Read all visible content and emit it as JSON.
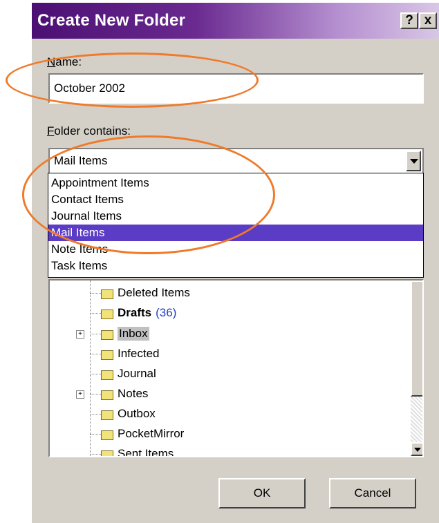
{
  "dialog": {
    "title": "Create New Folder",
    "help_glyph": "?",
    "close_glyph": "x"
  },
  "name_field": {
    "label_accel": "N",
    "label_rest": "ame:",
    "value": "October 2002"
  },
  "folder_contains": {
    "label_accel": "F",
    "label_rest": "older contains:",
    "selected": "Mail Items",
    "options": [
      "Appointment Items",
      "Contact Items",
      "Journal Items",
      "Mail Items",
      "Note Items",
      "Task Items"
    ]
  },
  "tree": {
    "items": [
      {
        "name": "Deleted Items",
        "icon": "deleted-items-folder-icon"
      },
      {
        "name": "Drafts",
        "count": "(36)",
        "icon": "drafts-folder-icon"
      },
      {
        "name": "Inbox",
        "icon": "inbox-folder-icon"
      },
      {
        "name": "Infected",
        "icon": "folder-icon"
      },
      {
        "name": "Journal",
        "icon": "journal-folder-icon"
      },
      {
        "name": "Notes",
        "icon": "notes-folder-icon"
      },
      {
        "name": "Outbox",
        "icon": "outbox-folder-icon"
      },
      {
        "name": "PocketMirror",
        "icon": "folder-icon"
      },
      {
        "name": "Sent Items",
        "icon": "sent-items-folder-icon"
      }
    ]
  },
  "buttons": {
    "ok": "OK",
    "cancel": "Cancel"
  },
  "colors": {
    "title_gradient_start": "#4b0f74",
    "selection": "#5b3cc4",
    "annotation": "#f07a2a",
    "unread_count": "#2040c0"
  }
}
